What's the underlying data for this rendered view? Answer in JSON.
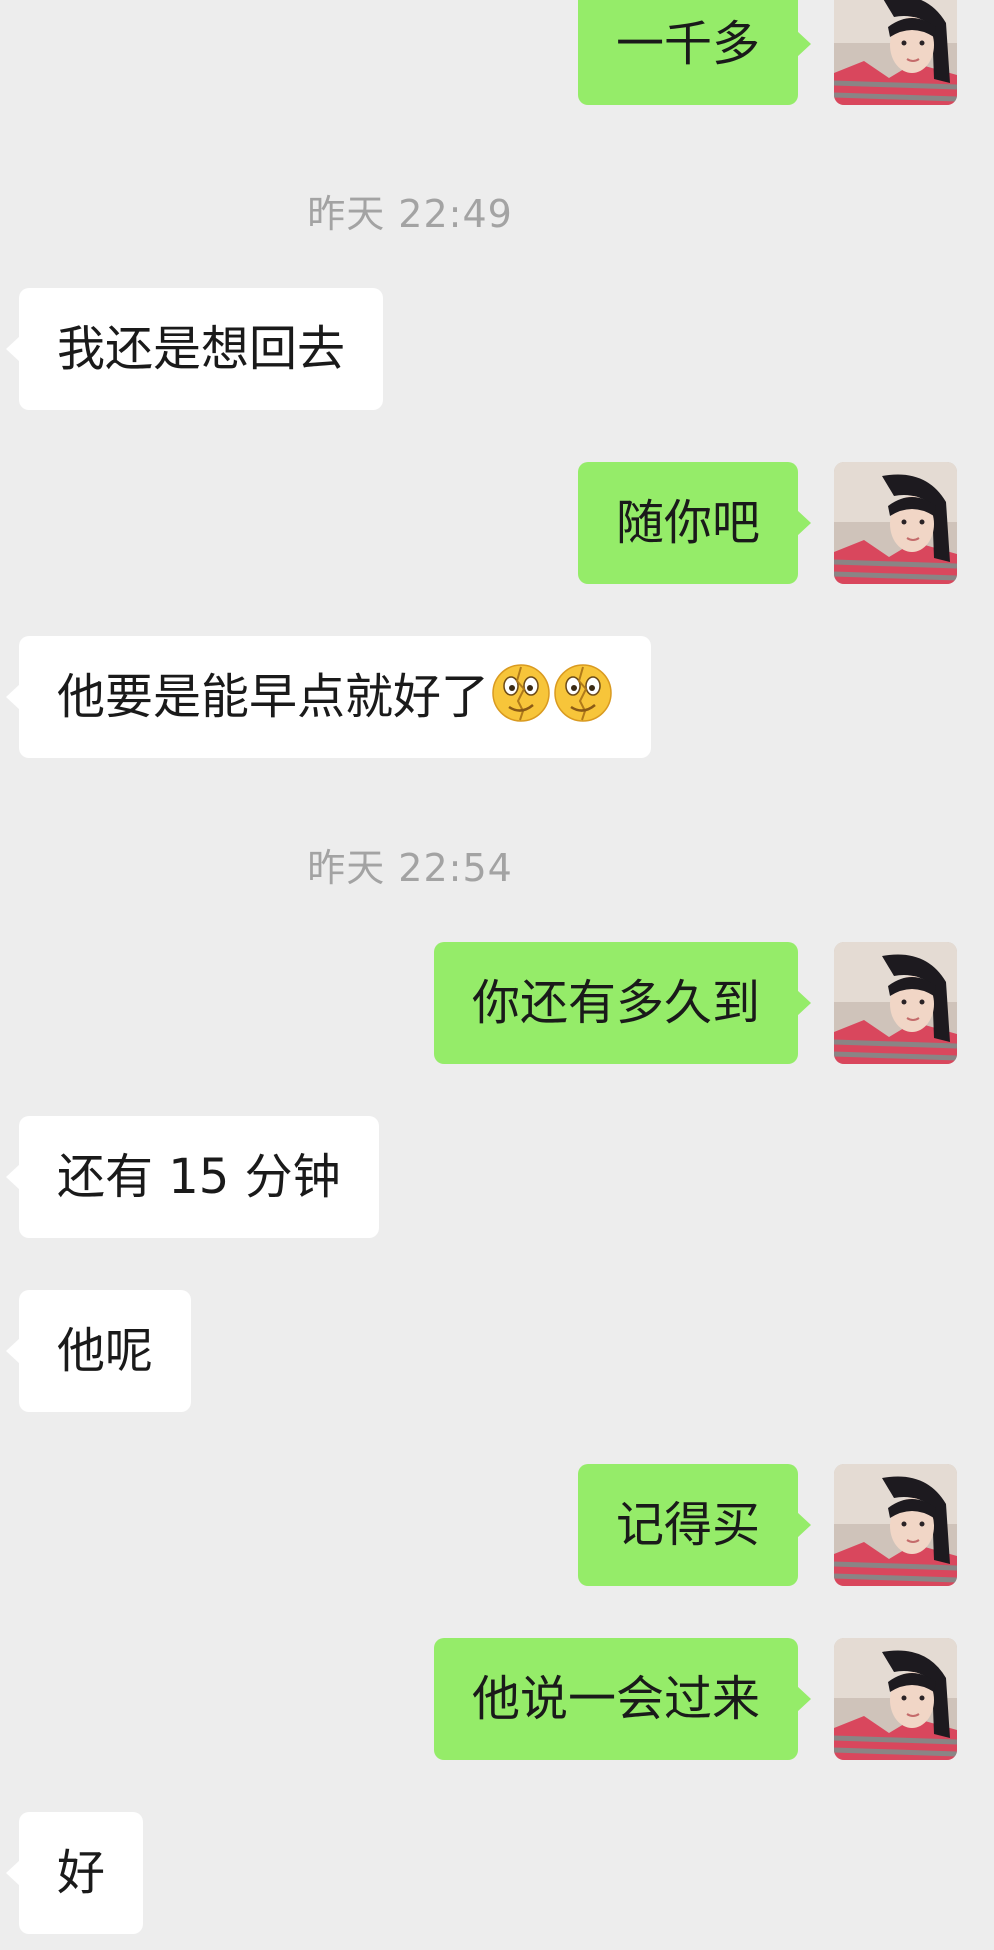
{
  "timestamps": [
    "昨天 22:49",
    "昨天 22:54"
  ],
  "messages": [
    {
      "side": "out",
      "text": "一千多"
    },
    {
      "side": "in",
      "text": "我还是想回去"
    },
    {
      "side": "out",
      "text": "随你吧"
    },
    {
      "side": "in",
      "text": "他要是能早点就好了",
      "emojis": [
        "broken-face-emoji",
        "broken-face-emoji"
      ]
    },
    {
      "side": "out",
      "text": "你还有多久到"
    },
    {
      "side": "in",
      "text": "还有 15 分钟"
    },
    {
      "side": "in",
      "text": "他呢"
    },
    {
      "side": "out",
      "text": "记得买"
    },
    {
      "side": "out",
      "text": "他说一会过来"
    },
    {
      "side": "in",
      "text": "好"
    }
  ],
  "colors": {
    "background": "#ededed",
    "outgoing_bubble": "#95ec69",
    "incoming_bubble": "#ffffff",
    "timestamp_text": "#a3a3a3"
  }
}
